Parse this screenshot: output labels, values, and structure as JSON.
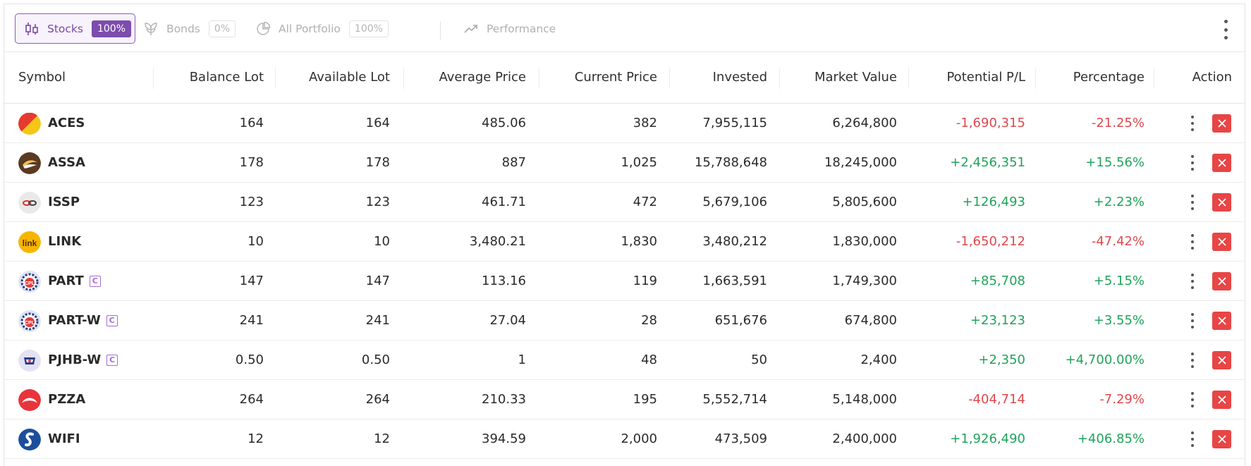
{
  "tabs": [
    {
      "label": "Stocks",
      "pct": "100%"
    },
    {
      "label": "Bonds",
      "pct": "0%"
    },
    {
      "label": "All Portfolio",
      "pct": "100%"
    },
    {
      "label": "Performance"
    }
  ],
  "columns": [
    "Symbol",
    "Balance Lot",
    "Available Lot",
    "Average Price",
    "Current Price",
    "Invested",
    "Market Value",
    "Potential P/L",
    "Percentage",
    "Action"
  ],
  "colors": {
    "accent": "#7c4cae",
    "negative": "#e0474c",
    "positive": "#1fa35a",
    "remove": "#e84545"
  },
  "rows": [
    {
      "symbol": "ACES",
      "badge": "",
      "balance": "164",
      "available": "164",
      "avg": "485.06",
      "current": "382",
      "invested": "7,955,115",
      "market": "6,264,800",
      "pl": "-1,690,315",
      "pct": "-21.25%",
      "trend": "neg"
    },
    {
      "symbol": "ASSA",
      "badge": "",
      "balance": "178",
      "available": "178",
      "avg": "887",
      "current": "1,025",
      "invested": "15,788,648",
      "market": "18,245,000",
      "pl": "+2,456,351",
      "pct": "+15.56%",
      "trend": "pos"
    },
    {
      "symbol": "ISSP",
      "badge": "",
      "balance": "123",
      "available": "123",
      "avg": "461.71",
      "current": "472",
      "invested": "5,679,106",
      "market": "5,805,600",
      "pl": "+126,493",
      "pct": "+2.23%",
      "trend": "pos"
    },
    {
      "symbol": "LINK",
      "badge": "",
      "balance": "10",
      "available": "10",
      "avg": "3,480.21",
      "current": "1,830",
      "invested": "3,480,212",
      "market": "1,830,000",
      "pl": "-1,650,212",
      "pct": "-47.42%",
      "trend": "neg"
    },
    {
      "symbol": "PART",
      "badge": "C",
      "balance": "147",
      "available": "147",
      "avg": "113.16",
      "current": "119",
      "invested": "1,663,591",
      "market": "1,749,300",
      "pl": "+85,708",
      "pct": "+5.15%",
      "trend": "pos"
    },
    {
      "symbol": "PART-W",
      "badge": "C",
      "balance": "241",
      "available": "241",
      "avg": "27.04",
      "current": "28",
      "invested": "651,676",
      "market": "674,800",
      "pl": "+23,123",
      "pct": "+3.55%",
      "trend": "pos"
    },
    {
      "symbol": "PJHB-W",
      "badge": "C",
      "balance": "0.50",
      "available": "0.50",
      "avg": "1",
      "current": "48",
      "invested": "50",
      "market": "2,400",
      "pl": "+2,350",
      "pct": "+4,700.00%",
      "trend": "pos"
    },
    {
      "symbol": "PZZA",
      "badge": "",
      "balance": "264",
      "available": "264",
      "avg": "210.33",
      "current": "195",
      "invested": "5,552,714",
      "market": "5,148,000",
      "pl": "-404,714",
      "pct": "-7.29%",
      "trend": "neg"
    },
    {
      "symbol": "WIFI",
      "badge": "",
      "balance": "12",
      "available": "12",
      "avg": "394.59",
      "current": "2,000",
      "invested": "473,509",
      "market": "2,400,000",
      "pl": "+1,926,490",
      "pct": "+406.85%",
      "trend": "pos"
    }
  ]
}
